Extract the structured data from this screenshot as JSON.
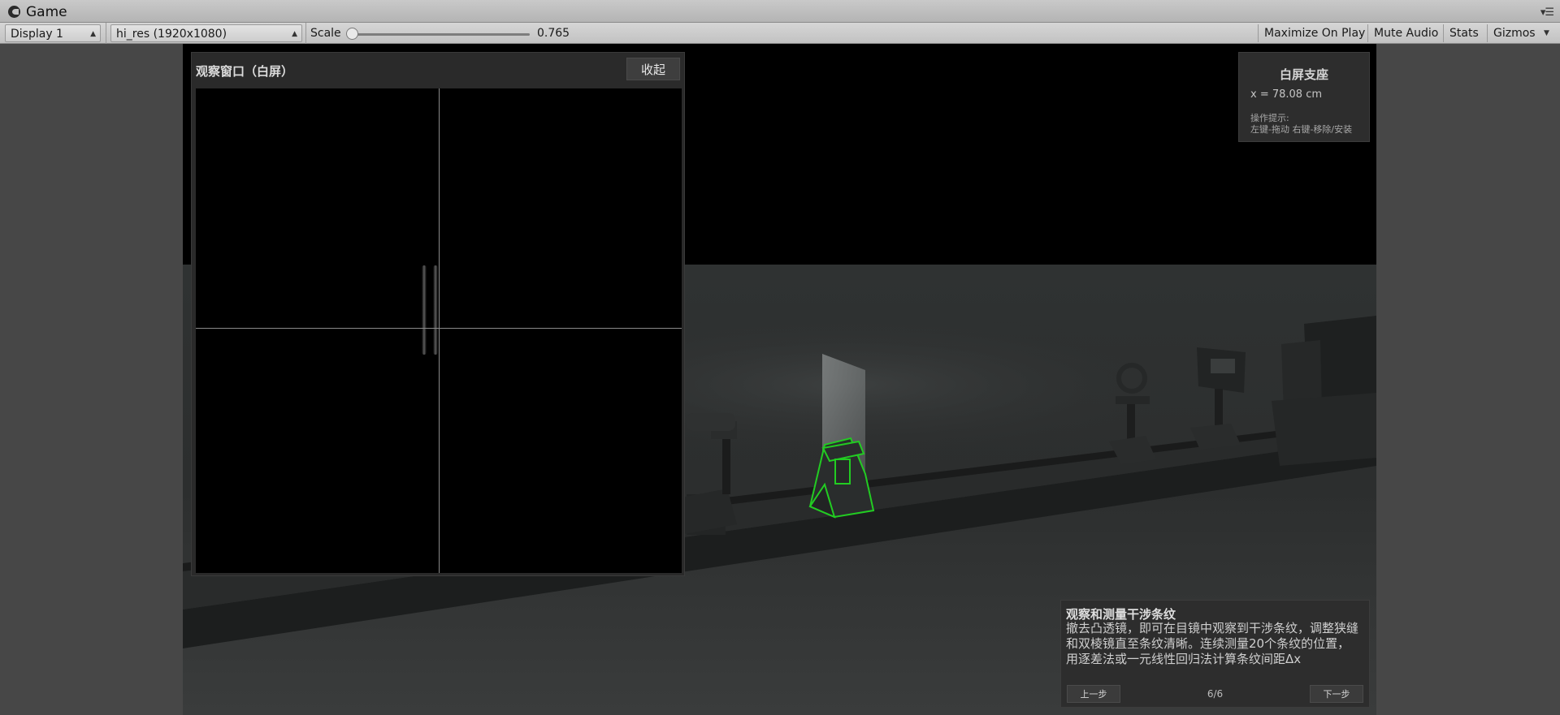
{
  "window": {
    "title": "Game",
    "menu_icon": "menu-icon"
  },
  "toolbar": {
    "display": "Display 1",
    "resolution": "hi_res (1920x1080)",
    "scale_label": "Scale",
    "scale_value": "0.765",
    "scale_level": 0.765,
    "buttons": [
      "Maximize On Play",
      "Mute Audio",
      "Stats",
      "Gizmos"
    ]
  },
  "observation_window": {
    "title": "观察窗口（白屏）",
    "collapse_button": "收起"
  },
  "info_panel": {
    "title": "白屏支座",
    "value": "x = 78.08 cm",
    "hint_label": "操作提示:",
    "hint": "左键-拖动  右键-移除/安装"
  },
  "instruction_panel": {
    "title": "观察和测量干涉条纹",
    "lines": [
      "撤去凸透镜，即可在目镜中观察到干涉条纹，调整狭缝",
      "和双棱镜直至条纹清晰。连续测量20个条纹的位置，",
      "用逐差法或一元线性回归法计算条纹间距Δx"
    ],
    "prev_button": "上一步",
    "next_button": "下一步",
    "page": "6/6"
  },
  "colors": {
    "highlight": "#22cc22",
    "panel_bg": "#2d2d2d",
    "editor_bg": "#474747"
  }
}
